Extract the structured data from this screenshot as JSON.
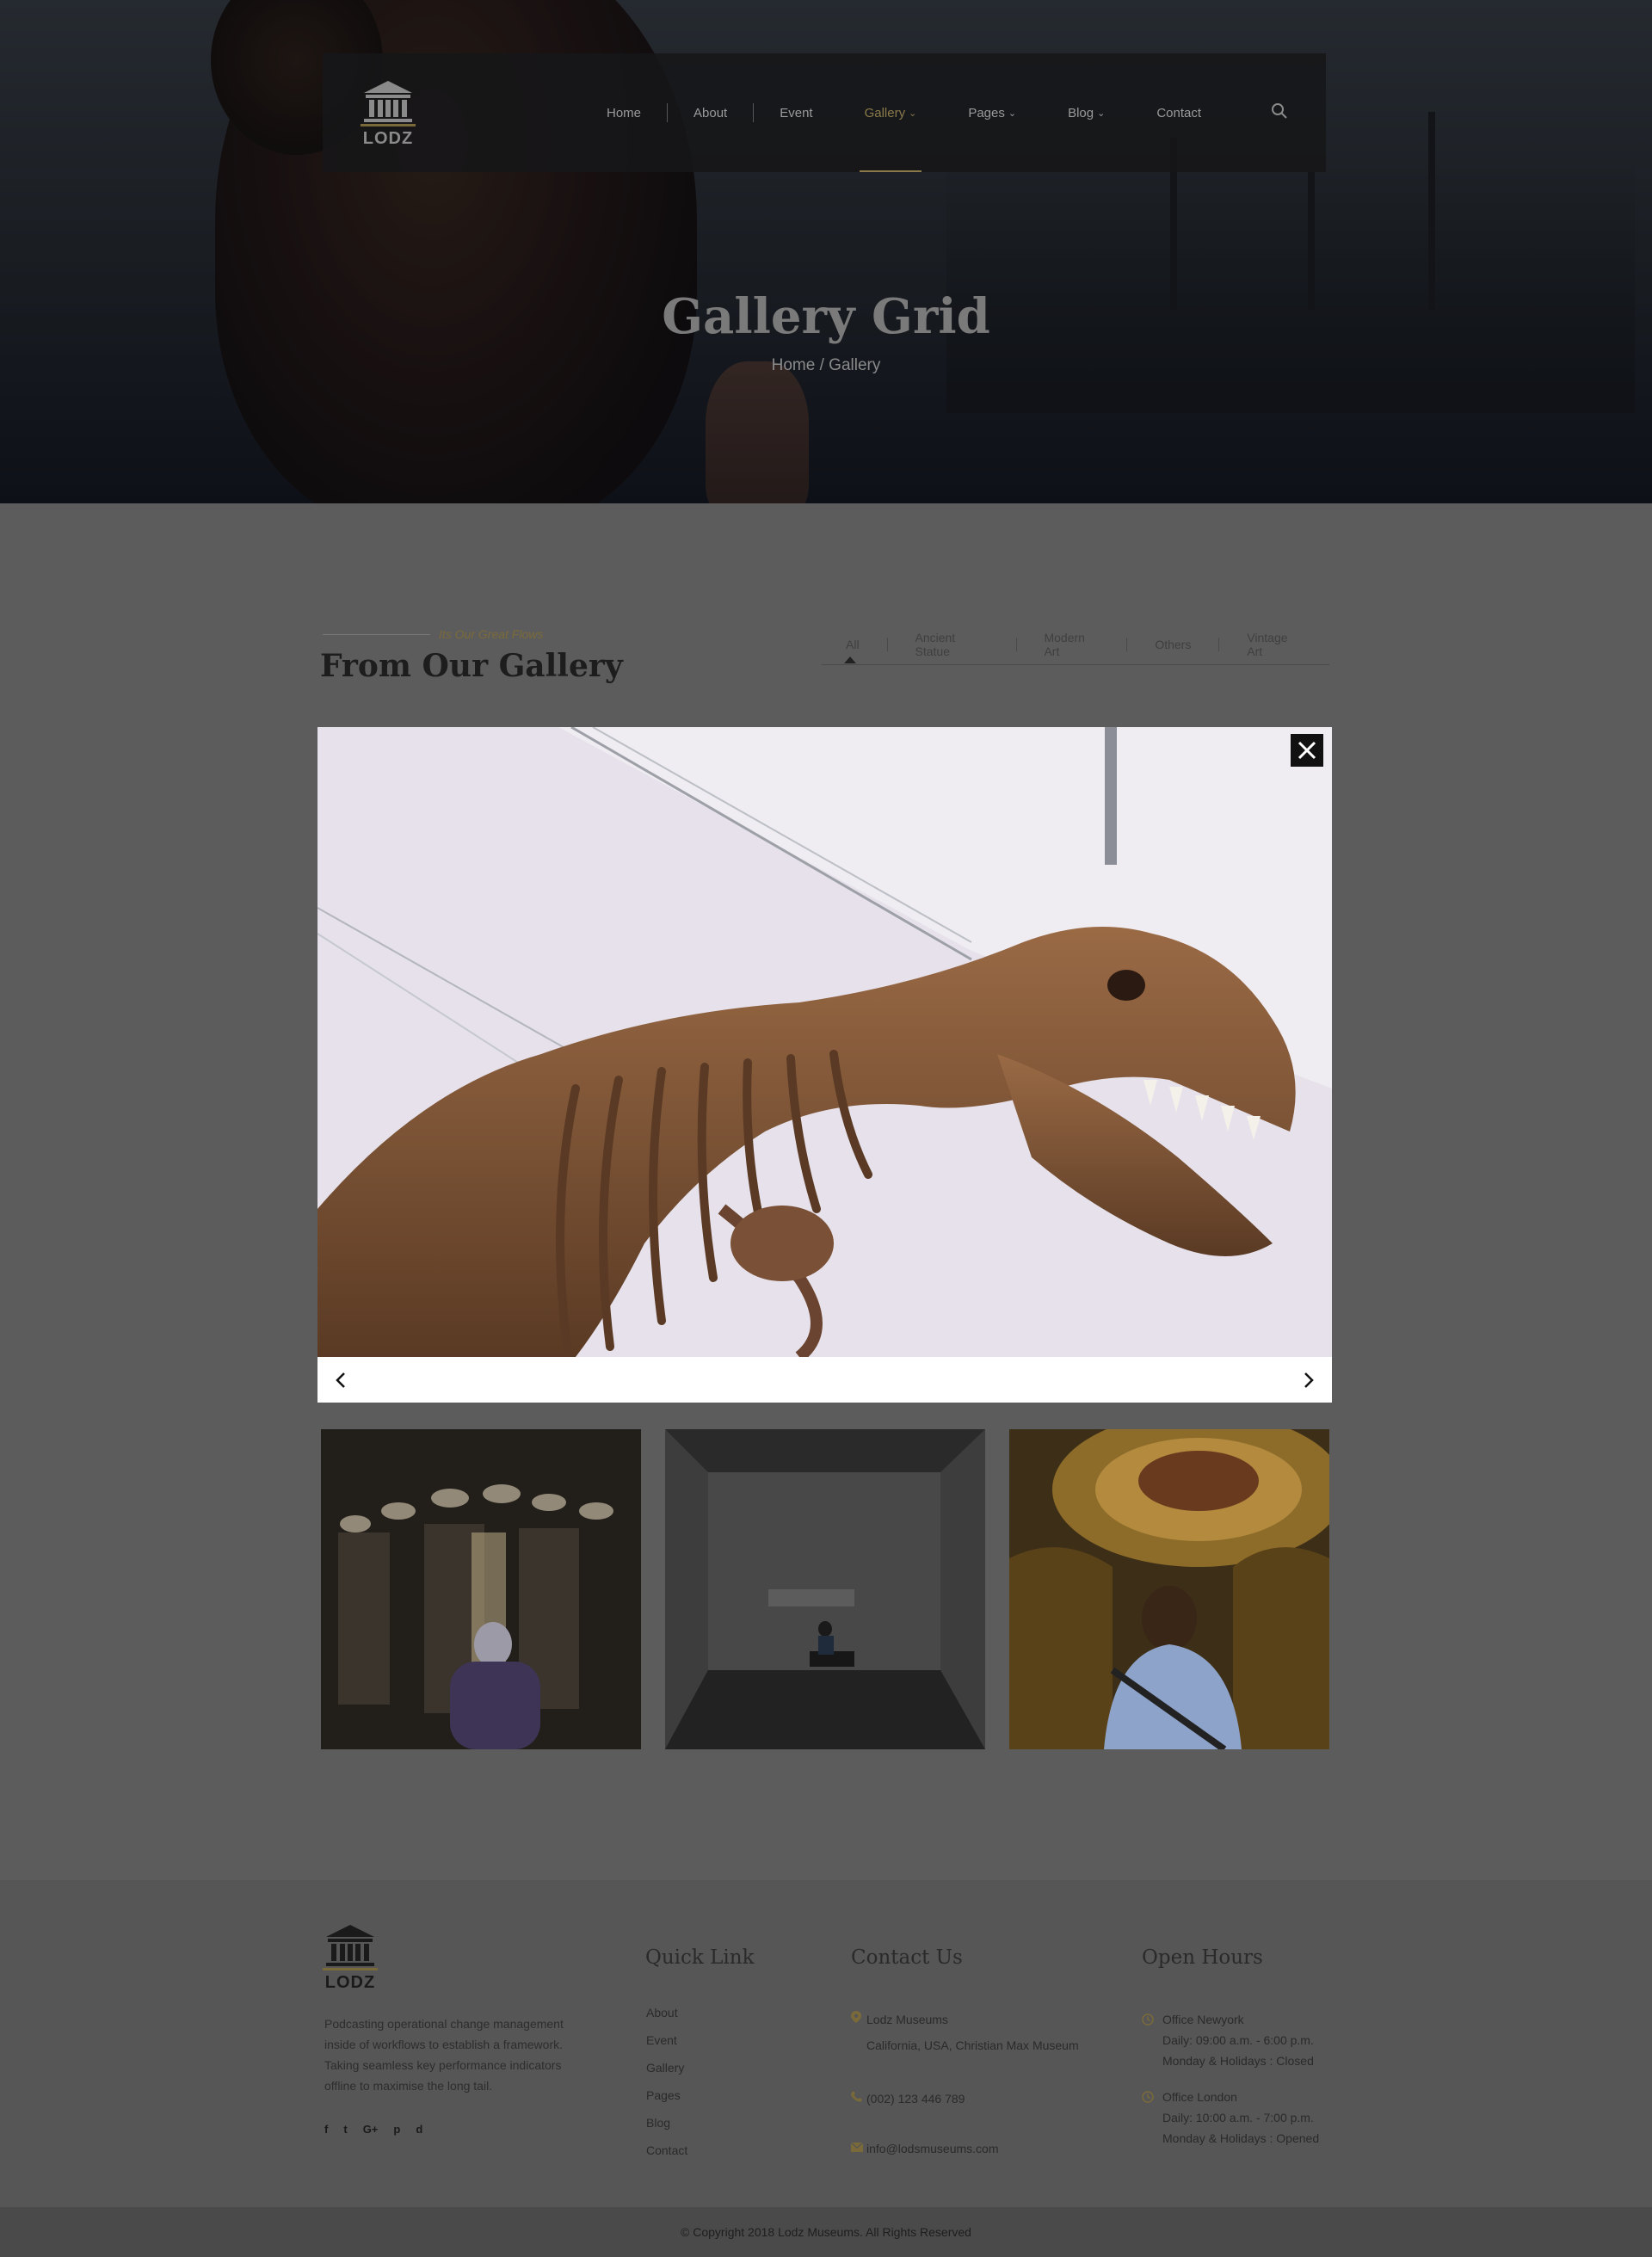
{
  "brand": {
    "logo_text": "LODZ"
  },
  "nav": {
    "items": [
      {
        "label": "Home",
        "caret": ""
      },
      {
        "label": "About",
        "caret": ""
      },
      {
        "label": "Event",
        "caret": ""
      },
      {
        "label": "Gallery",
        "caret": "⌄"
      },
      {
        "label": "Pages",
        "caret": "⌄"
      },
      {
        "label": "Blog",
        "caret": "⌄"
      },
      {
        "label": "Contact",
        "caret": ""
      }
    ],
    "active_index": 3
  },
  "hero": {
    "title": "Gallery Grid",
    "breadcrumb": "Home / Gallery"
  },
  "section": {
    "eyebrow": "Its Our Great Flows",
    "title": "From Our Gallery",
    "filters": [
      "All",
      "Ancient Statue",
      "Modern Art",
      "Others",
      "Vintage Art"
    ],
    "active_filter": "All"
  },
  "lightbox": {
    "close_icon": "close-icon",
    "prev_icon": "chevron-left-icon",
    "next_icon": "chevron-right-icon"
  },
  "footer": {
    "logo_text": "LODZ",
    "description": "Podcasting operational change management inside of workflows to establish a framework. Taking seamless key performance indicators offline to maximise the long tail.",
    "social": [
      "f",
      "t",
      "G+",
      "p",
      "d"
    ],
    "quick_link_title": "Quick Link",
    "quick_links": [
      "About",
      "Event",
      "Gallery",
      "Pages",
      "Blog",
      "Contact"
    ],
    "contact_title": "Contact Us",
    "contact": {
      "name": "Lodz  Museums",
      "address": "California, USA, Christian Max Museum",
      "phone": "(002) 123 446 789",
      "email": "info@lodsmuseums.com"
    },
    "hours_title": "Open Hours",
    "hours": [
      {
        "office": "Office Newyork",
        "daily": "Daily: 09:00 a.m. - 6:00 p.m.",
        "holidays": "Monday & Holidays : Closed"
      },
      {
        "office": "Office London",
        "daily": "Daily: 10:00 a.m. - 7:00 p.m.",
        "holidays": "Monday & Holidays : Opened"
      }
    ]
  },
  "copyright": "© Copyright 2018 Lodz Museums. All Rights Reserved",
  "colors": {
    "accent": "#8a7a4a",
    "overlay": "#5c5c5c"
  }
}
